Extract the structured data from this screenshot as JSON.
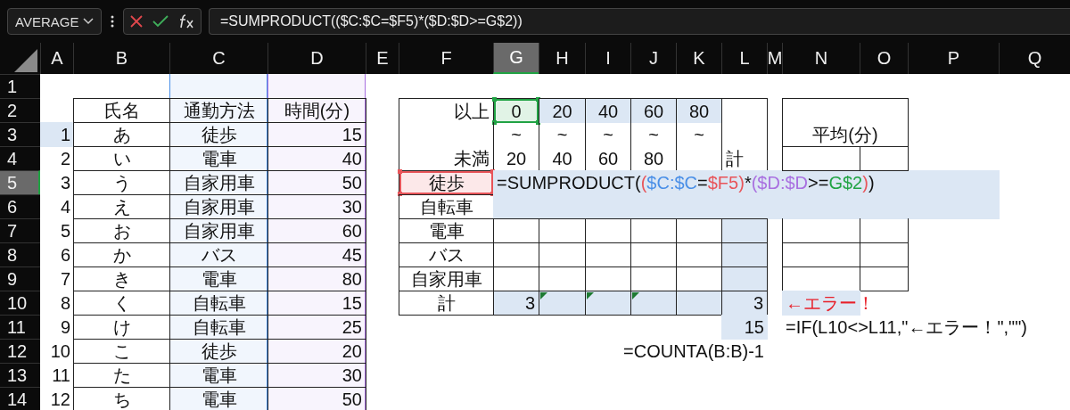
{
  "name_box": {
    "value": "AVERAGE"
  },
  "formula_bar": {
    "value": "=SUMPRODUCT(($C:$C=$F5)*($D:$D>=G$2))"
  },
  "columns": [
    {
      "label": "A",
      "selected": false
    },
    {
      "label": "B",
      "selected": false
    },
    {
      "label": "C",
      "selected": false,
      "color": "#4a8fe7"
    },
    {
      "label": "D",
      "selected": false,
      "color": "#a970e0"
    },
    {
      "label": "E",
      "selected": false
    },
    {
      "label": "F",
      "selected": false
    },
    {
      "label": "G",
      "selected": true
    },
    {
      "label": "H",
      "selected": false
    },
    {
      "label": "I",
      "selected": false
    },
    {
      "label": "J",
      "selected": false
    },
    {
      "label": "K",
      "selected": false
    },
    {
      "label": "L",
      "selected": false
    },
    {
      "label": "M",
      "selected": false
    },
    {
      "label": "N",
      "selected": false
    },
    {
      "label": "O",
      "selected": false
    },
    {
      "label": "P",
      "selected": false
    },
    {
      "label": "Q",
      "selected": false
    }
  ],
  "rows": [
    {
      "label": "1",
      "selected": false
    },
    {
      "label": "2",
      "selected": false
    },
    {
      "label": "3",
      "selected": false
    },
    {
      "label": "4",
      "selected": false
    },
    {
      "label": "5",
      "selected": true
    },
    {
      "label": "6",
      "selected": false
    },
    {
      "label": "7",
      "selected": false
    },
    {
      "label": "8",
      "selected": false
    },
    {
      "label": "9",
      "selected": false
    },
    {
      "label": "10",
      "selected": false
    },
    {
      "label": "11",
      "selected": false
    },
    {
      "label": "12",
      "selected": false
    },
    {
      "label": "13",
      "selected": false
    },
    {
      "label": "14",
      "selected": false
    }
  ],
  "roster": {
    "headers": [
      "氏名",
      "通勤方法",
      "時間(分)"
    ],
    "rows": [
      {
        "no": "1",
        "name": "あ",
        "method": "徒歩",
        "minutes": "15",
        "selected": true
      },
      {
        "no": "2",
        "name": "い",
        "method": "電車",
        "minutes": "40",
        "selected": false
      },
      {
        "no": "3",
        "name": "う",
        "method": "自家用車",
        "minutes": "50",
        "selected": false
      },
      {
        "no": "4",
        "name": "え",
        "method": "自家用車",
        "minutes": "30",
        "selected": false
      },
      {
        "no": "5",
        "name": "お",
        "method": "自家用車",
        "minutes": "60",
        "selected": false
      },
      {
        "no": "6",
        "name": "か",
        "method": "バス",
        "minutes": "45",
        "selected": false
      },
      {
        "no": "7",
        "name": "き",
        "method": "電車",
        "minutes": "80",
        "selected": false
      },
      {
        "no": "8",
        "name": "く",
        "method": "自転車",
        "minutes": "15",
        "selected": false
      },
      {
        "no": "9",
        "name": "け",
        "method": "自転車",
        "minutes": "25",
        "selected": false
      },
      {
        "no": "10",
        "name": "こ",
        "method": "徒歩",
        "minutes": "20",
        "selected": false
      },
      {
        "no": "11",
        "name": "た",
        "method": "電車",
        "minutes": "30",
        "selected": false
      },
      {
        "no": "12",
        "name": "ち",
        "method": "電車",
        "minutes": "50",
        "selected": false
      }
    ]
  },
  "cross_table": {
    "lower_label": "以上",
    "upper_label": "未満",
    "total_header": "計",
    "bins": [
      {
        "from": "0",
        "tilde": "~",
        "to": "20",
        "color": "#21a344"
      },
      {
        "from": "20",
        "tilde": "~",
        "to": "40",
        "selected": true
      },
      {
        "from": "40",
        "tilde": "~",
        "to": "60",
        "selected": true
      },
      {
        "from": "60",
        "tilde": "~",
        "to": "80",
        "selected": true
      },
      {
        "from": "80",
        "tilde": "~",
        "selected": true
      }
    ],
    "rows": [
      {
        "label": "徒歩",
        "color": "#e8555a",
        "cells": [
          {
            "selected": true
          },
          {
            "selected": true
          },
          {
            "selected": true
          },
          {
            "selected": true
          },
          {
            "selected": true
          }
        ],
        "total": {
          "selected": true
        },
        "beyond": [
          {
            "selected": true
          },
          {
            "selected": true
          },
          {
            "selected": true
          },
          {
            "selected": true
          }
        ],
        "formula": [
          {
            "text": "=SUMPRODUCT("
          },
          {
            "text": "(",
            "color": "#e8555a"
          },
          {
            "text": "$C:$C",
            "color": "#4a8fe7"
          },
          {
            "text": "="
          },
          {
            "text": "$F5",
            "color": "#e8555a"
          },
          {
            "text": ")",
            "color": "#e8555a"
          },
          {
            "text": "*"
          },
          {
            "text": "(",
            "color": "#a970e0"
          },
          {
            "text": "$D:$D",
            "color": "#a970e0"
          },
          {
            "text": ">="
          },
          {
            "text": "G$2",
            "color": "#21a344"
          },
          {
            "text": ")",
            "color": "#e8555a"
          },
          {
            "text": ")"
          }
        ]
      },
      {
        "label": "自転車",
        "cells": [
          {
            "selected": true
          },
          {
            "selected": true
          },
          {
            "selected": true
          },
          {
            "selected": true
          },
          {
            "selected": true
          }
        ],
        "total": {
          "selected": true
        },
        "beyond": [
          {
            "selected": true
          },
          {
            "selected": true
          },
          {
            "selected": true
          },
          {
            "selected": true
          }
        ]
      },
      {
        "label": "電車",
        "total": {
          "selected": true
        }
      },
      {
        "label": "バス",
        "total": {
          "selected": true
        }
      },
      {
        "label": "自家用車",
        "total": {
          "selected": true
        }
      }
    ],
    "total_row": {
      "label": "計",
      "cells": [
        {
          "text": "3",
          "selected": true
        },
        {
          "selected": true,
          "error_flag": true
        },
        {
          "selected": true,
          "error_flag": true
        },
        {
          "selected": true,
          "error_flag": true
        },
        {
          "selected": true
        }
      ],
      "total": {
        "text": "3",
        "selected": true
      }
    }
  },
  "average_table": {
    "title": "平均(分)",
    "rows": [
      {
        "selected": false
      },
      {
        "selected": false
      },
      {
        "selected": false
      },
      {
        "selected": false
      }
    ]
  },
  "checks": {
    "error_text": {
      "text": "←エラー！",
      "color": "#e8202a",
      "selected": true
    },
    "count": {
      "text": "15",
      "selected": true
    },
    "check_formula": "=IF(L10<>L11,\"←エラー！\",\"\")",
    "count_formula": "=COUNTA(B:B)-1"
  }
}
